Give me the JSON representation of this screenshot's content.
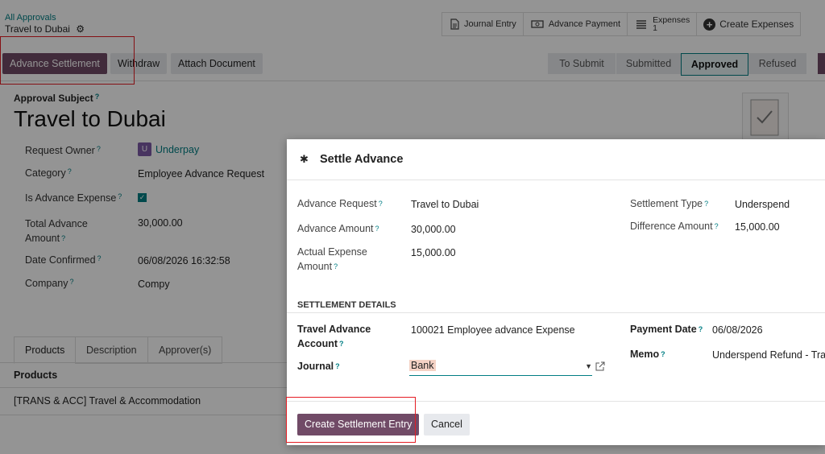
{
  "breadcrumb": {
    "parent": "All Approvals",
    "current": "Travel to Dubai"
  },
  "smart_buttons": {
    "journal_entry": "Journal Entry",
    "advance_payment": "Advance Payment",
    "expenses_label": "Expenses",
    "expenses_count": "1",
    "create_expenses": "Create Expenses"
  },
  "statusbar": {
    "advance_settlement": "Advance Settlement",
    "withdraw": "Withdraw",
    "attach_document": "Attach Document",
    "stages": [
      "To Submit",
      "Submitted",
      "Approved",
      "Refused"
    ],
    "active_stage": "Approved"
  },
  "form": {
    "subject_label": "Approval Subject",
    "subject": "Travel to Dubai",
    "request_owner_label": "Request Owner",
    "request_owner_avatar": "U",
    "request_owner": "Underpay",
    "category_label": "Category",
    "category": "Employee Advance Request",
    "is_advance_label": "Is Advance Expense",
    "is_advance": true,
    "total_advance_label": "Total Advance Amount",
    "total_advance_line1": "Total Advance",
    "total_advance_line2": "Amount",
    "total_advance": "30,000.00",
    "date_confirmed_label": "Date Confirmed",
    "date_confirmed": "06/08/2026 16:32:58",
    "company_label": "Company",
    "company": "Compy",
    "tabs": [
      "Products",
      "Description",
      "Approver(s)"
    ],
    "products_header": "Products",
    "product_line": "[TRANS & ACC] Travel & Accommodation"
  },
  "dialog": {
    "title": "Settle Advance",
    "advance_request_label": "Advance Request",
    "advance_request": "Travel to Dubai",
    "advance_amount_label": "Advance Amount",
    "advance_amount": "30,000.00",
    "actual_expense_line1": "Actual Expense",
    "actual_expense_line2": "Amount",
    "actual_expense": "15,000.00",
    "settlement_type_label": "Settlement Type",
    "settlement_type": "Underspend",
    "difference_amount_label": "Difference Amount",
    "difference_amount": "15,000.00",
    "section_title": "SETTLEMENT DETAILS",
    "travel_account_line1": "Travel Advance",
    "travel_account_line2": "Account",
    "travel_account": "100021 Employee advance Expense",
    "journal_label": "Journal",
    "journal": "Bank",
    "payment_date_label": "Payment Date",
    "payment_date": "06/08/2026",
    "memo_label": "Memo",
    "memo": "Underspend Refund - Trav",
    "create_button": "Create Settlement Entry",
    "cancel_button": "Cancel"
  },
  "colors": {
    "primary": "#714b67",
    "link": "#017e84",
    "highlight": "#e51c23"
  }
}
